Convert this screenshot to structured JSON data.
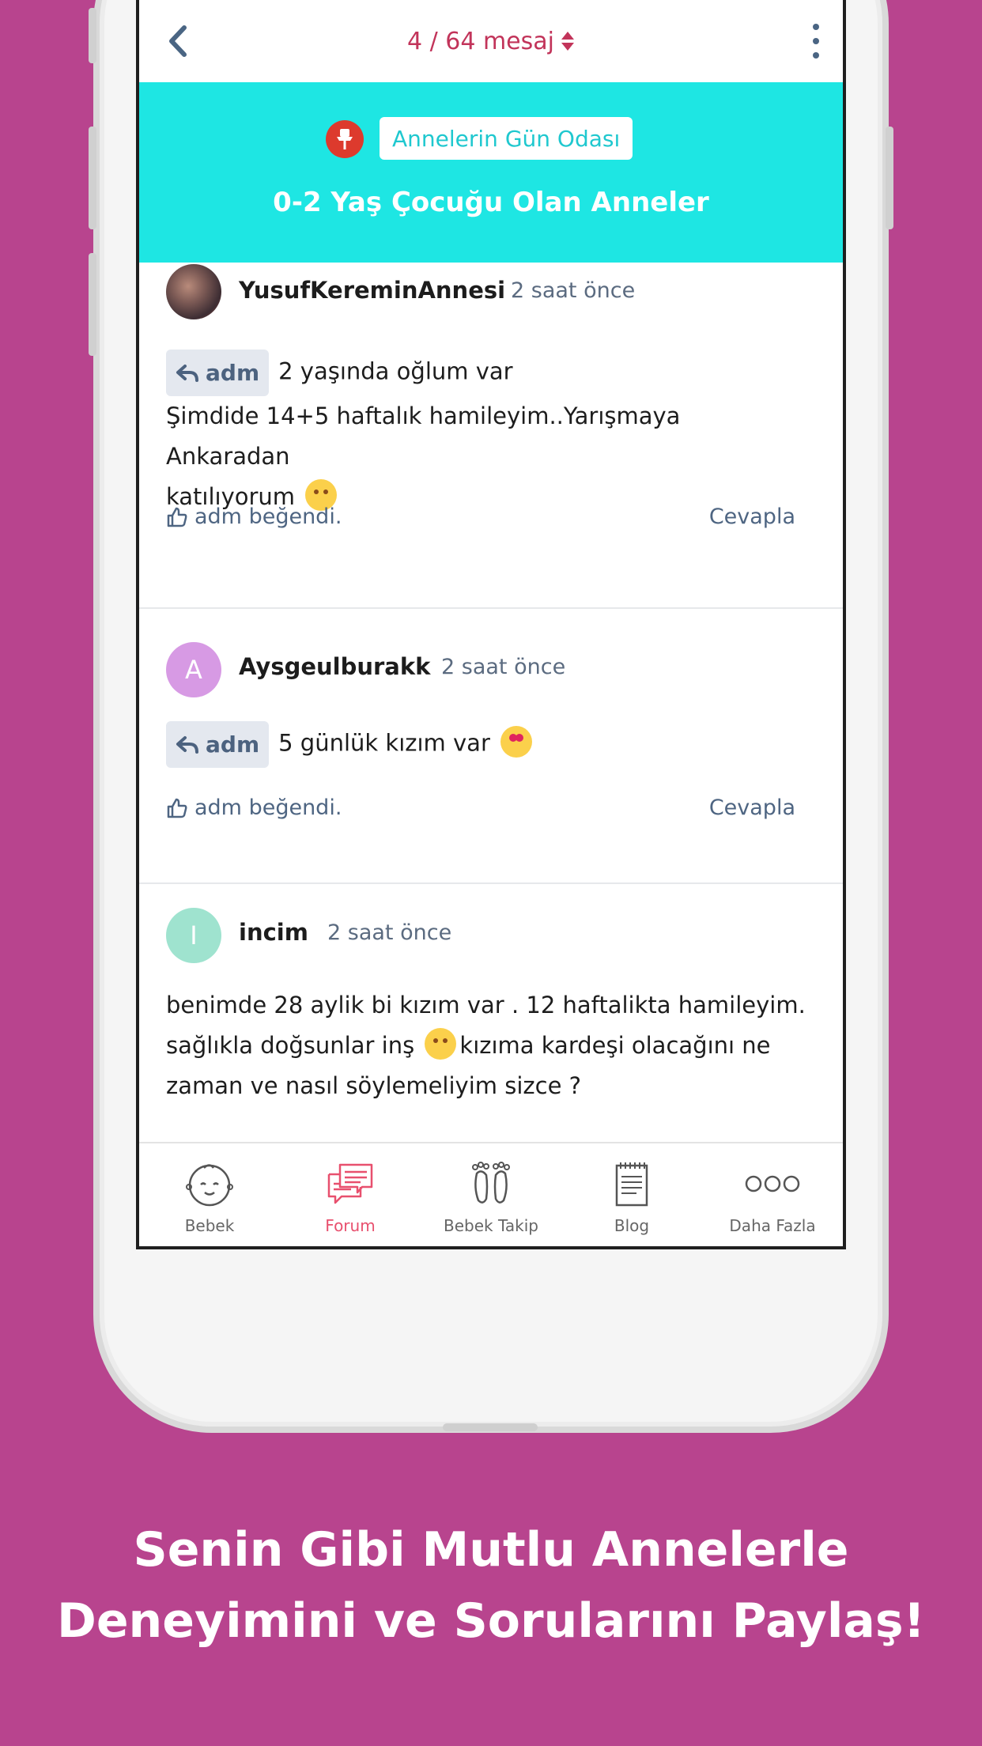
{
  "topbar": {
    "counter": "4 / 64 mesaj"
  },
  "banner": {
    "room_name": "Annelerin Gün Odası",
    "title": "0-2 Yaş Çocuğu Olan Anneler"
  },
  "posts": [
    {
      "username": "YusufKereminAnnesi",
      "time": "2 saat önce",
      "reply_to": "adm",
      "line1": "2 yaşında oğlum var",
      "line2": "Şimdide 14+5 haftalık hamileyim..Yarışmaya Ankaradan",
      "line3": "katılıyorum",
      "likes": "adm beğendi.",
      "reply_label": "Cevapla"
    },
    {
      "avatar_letter": "A",
      "username": "Aysgeulburakk",
      "time": "2 saat önce",
      "reply_to": "adm",
      "line1": "5 günlük kızım var",
      "likes": "adm beğendi.",
      "reply_label": "Cevapla"
    },
    {
      "avatar_letter": "I",
      "username": "incim",
      "time": "2 saat önce",
      "line1": "benimde 28 aylik bi kızım var . 12 haftalikta hamileyim.",
      "line2a": "sağlıkla doğsunlar inş",
      "line2b": "kızıma kardeşi olacağını ne",
      "line3": "zaman ve nasıl söylemeliyim sizce ?"
    }
  ],
  "tabs": [
    {
      "label": "Bebek",
      "icon": "baby-face-icon"
    },
    {
      "label": "Forum",
      "icon": "chat-bubbles-icon"
    },
    {
      "label": "Bebek Takip",
      "icon": "footprints-icon"
    },
    {
      "label": "Blog",
      "icon": "notepad-icon"
    },
    {
      "label": "Daha Fazla",
      "icon": "more-dots-icon"
    }
  ],
  "caption": {
    "line1": "Senin Gibi Mutlu Annelerle",
    "line2": "Deneyimini ve Sorularını Paylaş!"
  },
  "colors": {
    "background": "#b8448e",
    "banner": "#1ee6e3",
    "counter": "#c2345a",
    "active_tab": "#e8506e",
    "avatar_a": "#d79ae4",
    "avatar_i": "#9fe3cf"
  }
}
